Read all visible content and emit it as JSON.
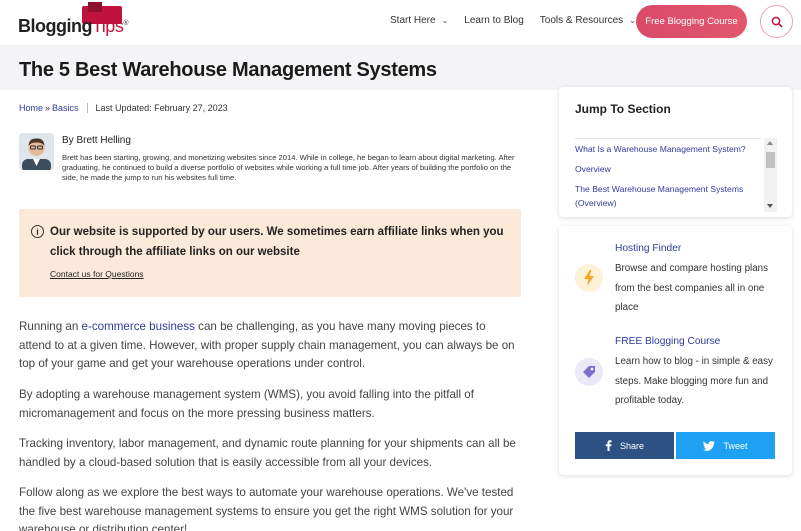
{
  "header": {
    "logo_main": "Blogging",
    "logo_accent": "Tips",
    "logo_tm": "®",
    "nav": [
      {
        "label": "Start Here",
        "has_dropdown": true
      },
      {
        "label": "Learn to Blog",
        "has_dropdown": false
      },
      {
        "label": "Tools & Resources",
        "has_dropdown": true
      }
    ],
    "cta_label": "Free Blogging Course",
    "search_icon": "search-icon"
  },
  "article": {
    "title": "The 5 Best Warehouse Management Systems",
    "breadcrumb": {
      "home": "Home",
      "sep": "»",
      "category": "Basics"
    },
    "last_updated": "Last Updated: February 27, 2023",
    "author": {
      "name": "By Brett Helling",
      "bio": "Brett has been starting, growing, and monetizing websites since 2014. While in college, he began to learn about digital marketing. After graduating, he continued to build a diverse portfolio of websites while working a full time job. After years of building the portfolio on the side, he made the jump to run his websites full time."
    },
    "notice": {
      "text": "Our website is supported by our users. We sometimes earn affiliate links when you click through the affiliate links on our website",
      "link": "Contact us for Questions"
    },
    "paragraphs": {
      "p1_before": "Running an ",
      "p1_link": "e-commerce business",
      "p1_after": " can be challenging, as you have many moving pieces to attend to at a given time. However, with proper supply chain management, you can always be on top of your game and get your warehouse operations under control.",
      "p2": "By adopting a warehouse management system (WMS), you avoid falling into the pitfall of micromanagement and focus on the more pressing business matters.",
      "p3": "Tracking inventory, labor management, and dynamic route planning for your shipments can all be handled by a cloud-based solution that is easily accessible from all your devices.",
      "p4": "Follow along as we explore the best ways to automate your warehouse operations. We've tested the five best warehouse management systems to ensure you get the right WMS solution for your warehouse or distribution center!"
    }
  },
  "sidebar": {
    "toc": {
      "title": "Jump To Section",
      "items": [
        "What Is a Warehouse Management System?",
        "Overview",
        "The Best Warehouse Management Systems (Overview)"
      ]
    },
    "promos": [
      {
        "title": "Hosting Finder",
        "text": "Browse and compare hosting plans from the best companies all in one place",
        "icon": "lightning-icon",
        "color": "#f5a623"
      },
      {
        "title": "FREE Blogging Course",
        "text": "Learn how to blog - in simple & easy steps. Make blogging more fun and profitable today.",
        "icon": "tag-icon",
        "color": "#7b6fd0"
      }
    ],
    "share_label": "Share",
    "tweet_label": "Tweet"
  },
  "colors": {
    "brand": "#c0123c",
    "link": "#2e3c9c",
    "cta": "#e0566c",
    "notice_bg": "#fbe9da",
    "facebook": "#2e5184",
    "twitter": "#1ea1f2"
  }
}
